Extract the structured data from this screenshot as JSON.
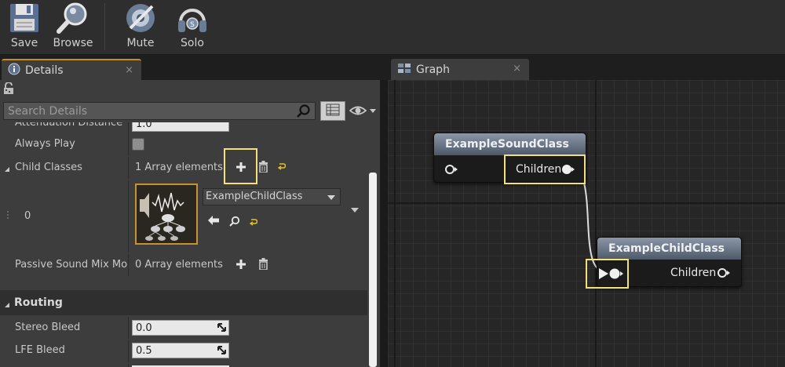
{
  "toolbar": {
    "save_label": "Save",
    "browse_label": "Browse",
    "mute_label": "Mute",
    "solo_label": "Solo"
  },
  "details_tab": {
    "label": "Details",
    "close": "×"
  },
  "graph_tab": {
    "label": "Graph",
    "close": "×"
  },
  "search": {
    "placeholder": "Search Details"
  },
  "properties": {
    "attenuation_name": "Attenuation Distance Sc",
    "attenuation_value": "1.0",
    "always_play_name": "Always Play",
    "child_classes_name": "Child Classes",
    "child_classes_value": "1 Array elements",
    "element_index": "0",
    "element_value": "ExampleChildClass",
    "passive_name": "Passive Sound Mix Mod",
    "passive_value": "0 Array elements"
  },
  "routing": {
    "title": "Routing",
    "stereo_bleed_name": "Stereo Bleed",
    "stereo_bleed_value": "0.0",
    "lfe_bleed_name": "LFE Bleed",
    "lfe_bleed_value": "0.5"
  },
  "graph": {
    "node1": {
      "title": "ExampleSoundClass",
      "output_pin": "Children"
    },
    "node2": {
      "title": "ExampleChildClass",
      "output_pin": "Children"
    }
  },
  "colors": {
    "highlight": "#f3e07a",
    "tab_accent": "#c88b1c",
    "node_header": "#6b7788",
    "wire": "#d8d8d8"
  }
}
